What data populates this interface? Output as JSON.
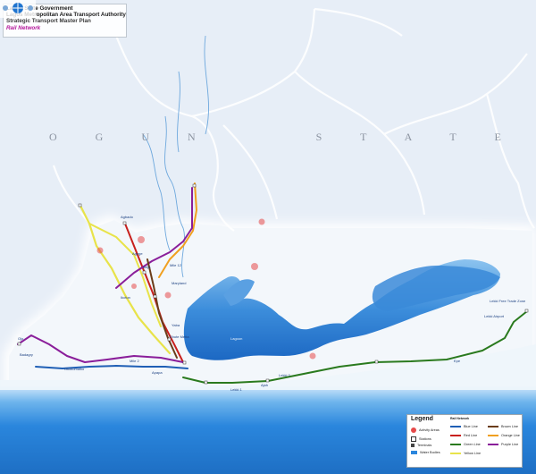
{
  "title_block": {
    "line1": "Lagos State Government",
    "line2": "Lagos Metropolitan Area Transport Authority",
    "line3": "Strategic Transport Master Plan",
    "line4": "Rail Network"
  },
  "region_label": "O G U N     S T A T E",
  "colors": {
    "blue_line": "#1f5fb5",
    "red_line": "#c8201d",
    "green_line": "#2a7a1e",
    "yellow_line": "#e8e34a",
    "brown_line": "#6b3d1a",
    "orange_line": "#f0a020",
    "purple_line": "#8a1e9a",
    "lagoon": "#1f74cf",
    "ocean": "#2a86dd",
    "activity_area": "#e64a4a"
  },
  "legend": {
    "title": "Legend",
    "subtitle": "Rail Network",
    "symbols": [
      {
        "label": "Activity Areas",
        "icon": "activity-area-icon"
      },
      {
        "label": "Stations",
        "icon": "station-icon"
      },
      {
        "label": "Terminals",
        "icon": "terminal-icon"
      },
      {
        "label": "Water Bodies",
        "icon": "water-icon"
      }
    ],
    "lines_col1": [
      {
        "label": "Blue Line",
        "color": "#1f5fb5"
      },
      {
        "label": "Red Line",
        "color": "#c8201d"
      },
      {
        "label": "Green Line",
        "color": "#2a7a1e"
      },
      {
        "label": "Yellow Line",
        "color": "#e8e34a"
      }
    ],
    "lines_col2": [
      {
        "label": "Brown Line",
        "color": "#6b3d1a"
      },
      {
        "label": "Orange Line",
        "color": "#f0a020"
      },
      {
        "label": "Purple Line",
        "color": "#8a1e9a"
      }
    ]
  },
  "station_labels": [
    "Agbado",
    "Ikeja",
    "Agege",
    "Mile 12",
    "Maryland",
    "Yaba",
    "Ebute Metta",
    "Okokomaiko",
    "Mile 2",
    "Apapa",
    "Lekki 1",
    "Lekki 2",
    "Ajah",
    "Epe",
    "Lekki Free Trade Zone",
    "Lekki Airport",
    "Badagry",
    "Ojo",
    "Ikotun"
  ],
  "water_label": "Lagoon"
}
